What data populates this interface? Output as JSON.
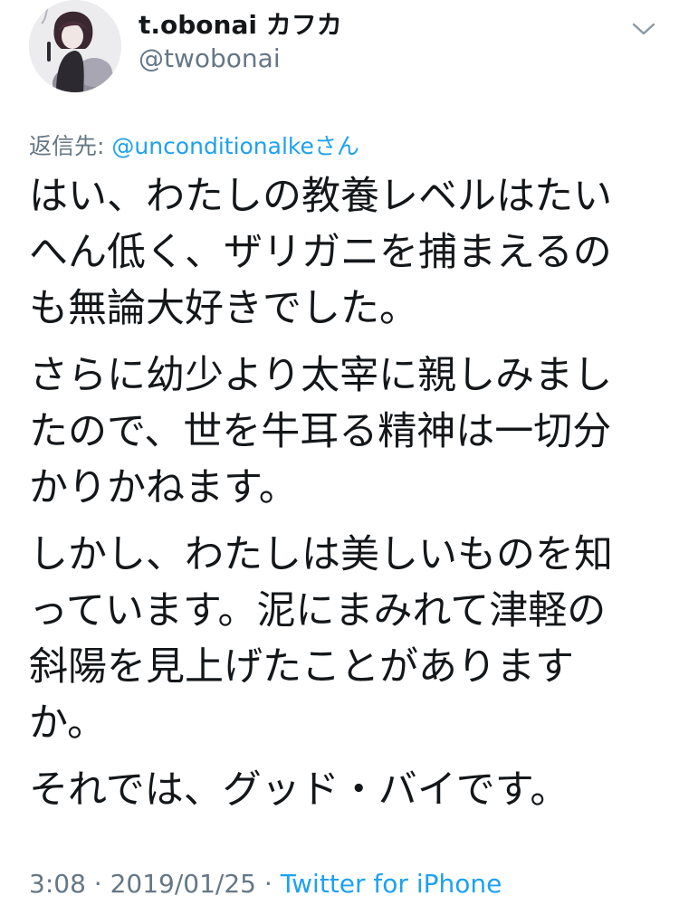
{
  "tweet": {
    "author": {
      "name": "t.obonai カフカ",
      "handle": "@twobonai"
    },
    "reply_to": {
      "label": "返信先: ",
      "user": "@unconditionalke",
      "suffix": "さん"
    },
    "paragraphs": [
      "はい、わたしの教養レベルはたい\nへん低く、ザリガニを捕まえるの\nも無論大好きでした。",
      "さらに幼少より太宰に親しみまし\nたので、世を牛耳る精神は一切分\nかりかねます。",
      "しかし、わたしは美しいものを知\nっています。泥にまみれて津軽の\n斜陽を見上げたことがあります\nか。",
      "それでは、グッド・バイです。"
    ],
    "meta": {
      "time": "3:08",
      "sep1": " · ",
      "date": "2019/01/25",
      "sep2": " · ",
      "source": "Twitter for iPhone"
    }
  },
  "colors": {
    "text": "#14171a",
    "secondary": "#657786",
    "link": "#1da1f2"
  },
  "icons": {
    "menu": "chevron-down-icon"
  }
}
